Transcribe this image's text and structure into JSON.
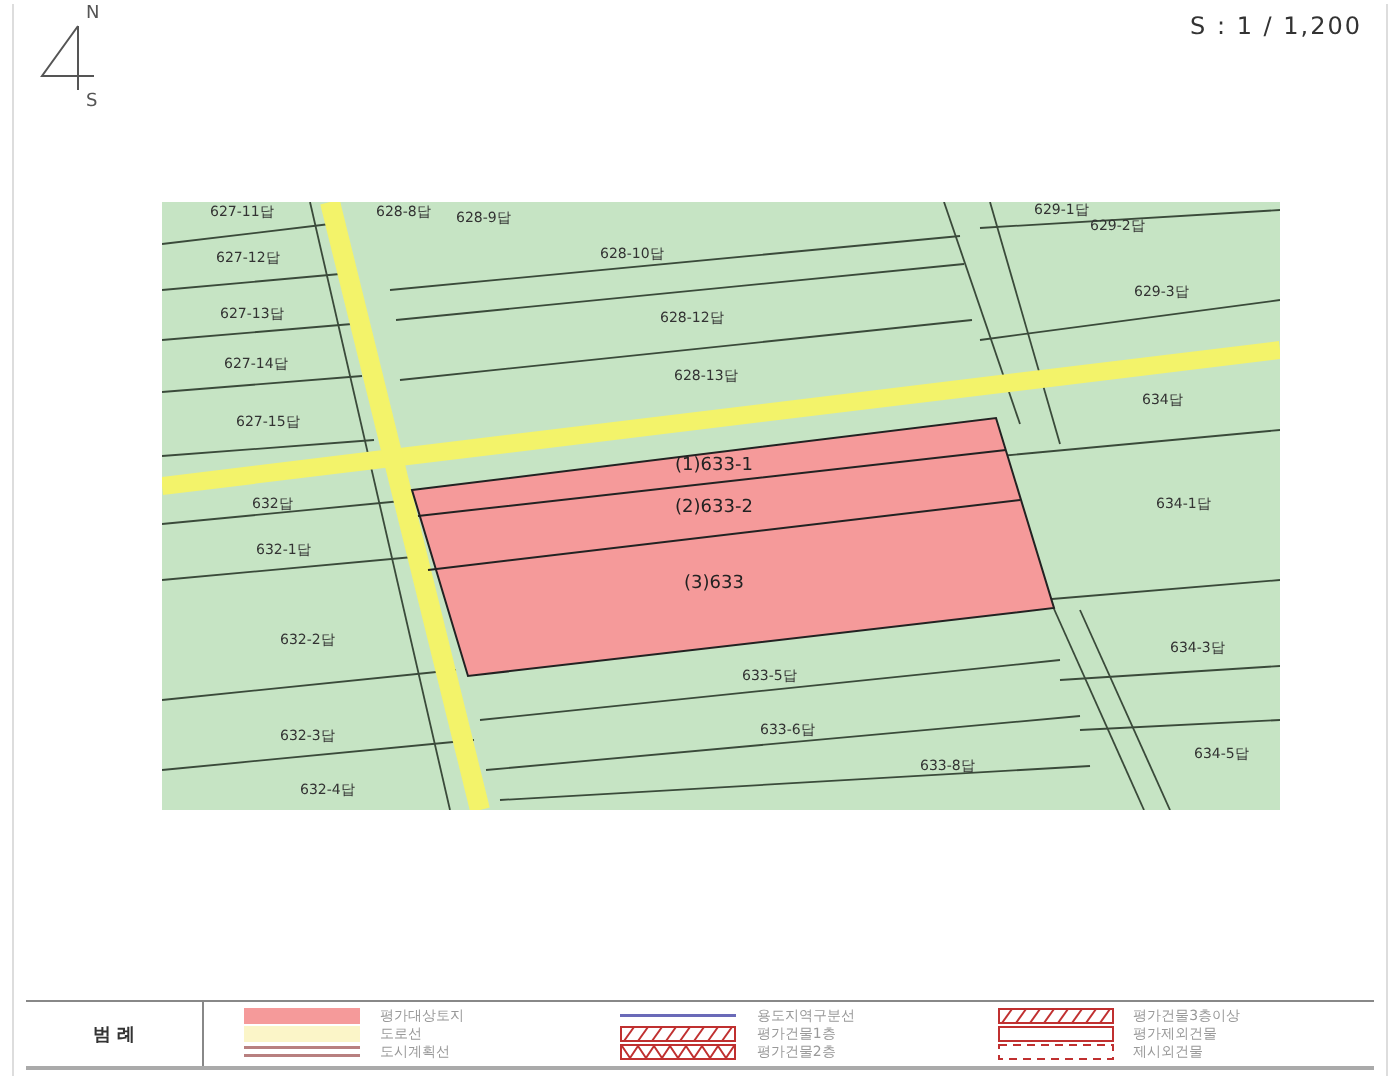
{
  "compass": {
    "north": "N",
    "south": "S"
  },
  "scale": "S : 1 / 1,200",
  "map": {
    "parcels": [
      "627-11답",
      "628-8답",
      "628-9답",
      "628-10답",
      "627-12답",
      "627-13답",
      "628-12답",
      "627-14답",
      "628-13답",
      "627-15답",
      "632답",
      "632-1답",
      "632-2답",
      "632-3답",
      "632-4답",
      "629-1답",
      "629-2답",
      "629-3답",
      "634답",
      "634-1답",
      "634-3답",
      "634-5답",
      "633-5답",
      "633-6답",
      "633-8답"
    ],
    "subject_lots": [
      "(1)633-1",
      "(2)633-2",
      "(3)633"
    ]
  },
  "legend": {
    "title": "범 례",
    "items": [
      {
        "kind": "fill",
        "label": "평가대상토지"
      },
      {
        "kind": "line",
        "label": "용도지역구분선"
      },
      {
        "kind": "hatch",
        "label": "평가건물3층이상"
      },
      {
        "kind": "road",
        "label": "도로선"
      },
      {
        "kind": "hatch",
        "label": "평가건물1층"
      },
      {
        "kind": "outline",
        "label": "평가제외건물"
      },
      {
        "kind": "double",
        "label": "도시계획선"
      },
      {
        "kind": "zigzag",
        "label": "평가건물2층"
      },
      {
        "kind": "dashed",
        "label": "제시외건물"
      }
    ]
  }
}
